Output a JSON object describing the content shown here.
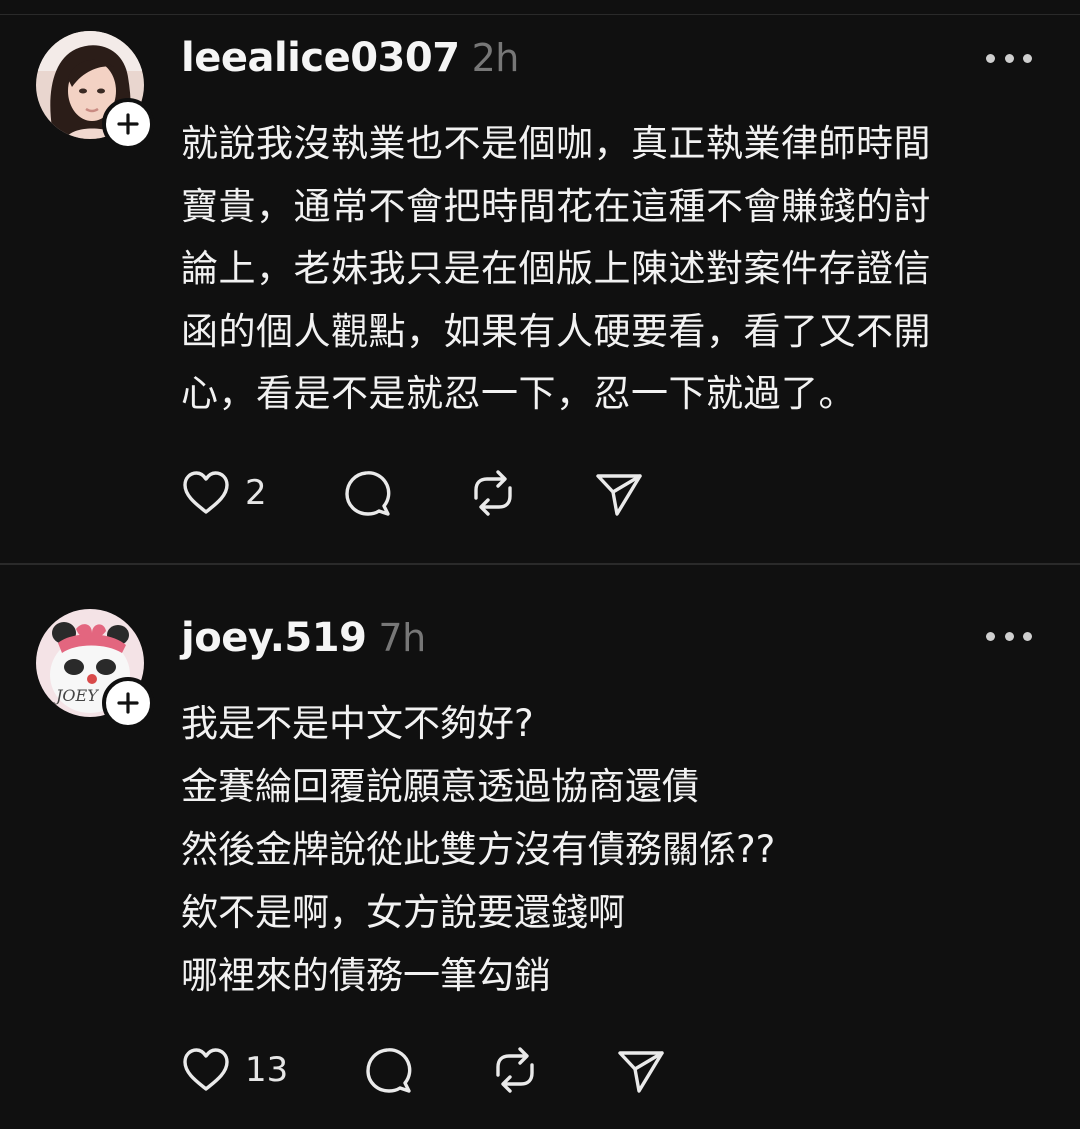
{
  "posts": [
    {
      "username": "leealice0307",
      "time": "2h",
      "lines": [
        "就說我沒執業也不是個咖，真正執業律師時間",
        "寶貴，通常不會把時間花在這種不會賺錢的討",
        "論上，老妹我只是在個版上陳述對案件存證信",
        "函的個人觀點，如果有人硬要看，看了又不開",
        "心，看是不是就忍一下，忍一下就過了。"
      ],
      "likes": "2",
      "avatar_icon": "profile-photo",
      "follow_icon": "plus-icon"
    },
    {
      "username": "joey.519",
      "time": "7h",
      "lines": [
        "我是不是中文不夠好?",
        "金賽綸回覆說願意透過協商還債",
        "然後金牌說從此雙方沒有債務關係??",
        "欸不是啊，女方說要還錢啊",
        "哪裡來的債務一筆勾銷"
      ],
      "likes": "13",
      "avatar_icon": "panda-avatar",
      "avatar_text": "JOEY",
      "follow_icon": "plus-icon"
    }
  ],
  "icons": {
    "like": "heart-icon",
    "comment": "comment-bubble-icon",
    "repost": "repost-icon",
    "share": "send-icon",
    "more": "more-dots-icon"
  },
  "colors": {
    "background": "#101010",
    "text": "#f3f3f3",
    "muted": "#777777",
    "divider": "#2a2a2a"
  }
}
